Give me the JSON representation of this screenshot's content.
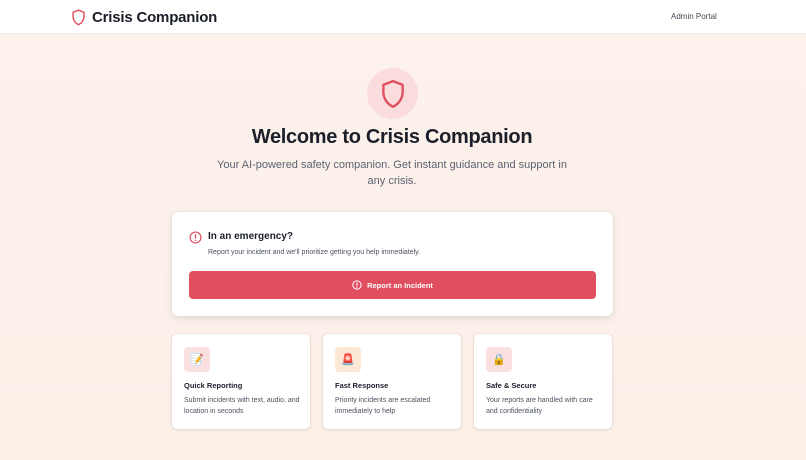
{
  "header": {
    "app_name": "Crisis Companion",
    "admin_link": "Admin Portal"
  },
  "hero": {
    "title": "Welcome to Crisis Companion",
    "subtitle": "Your AI-powered safety companion. Get instant guidance and support in any crisis."
  },
  "emergency": {
    "title": "In an emergency?",
    "description": "Report your incident and we'll prioritize getting you help immediately.",
    "button_label": "Report an Incident"
  },
  "features": [
    {
      "icon": "memo-pencil-icon",
      "title": "Quick Reporting",
      "description": "Submit incidents with text, audio, and location in seconds"
    },
    {
      "icon": "siren-icon",
      "title": "Fast Response",
      "description": "Priority incidents are escalated immediately to help"
    },
    {
      "icon": "lock-icon",
      "title": "Safe & Secure",
      "description": "Your reports are handled with care and confidentiality"
    }
  ],
  "colors": {
    "accent": "#e04f60",
    "accent_light": "#fbdcdc",
    "background": "#fdf1ec"
  }
}
